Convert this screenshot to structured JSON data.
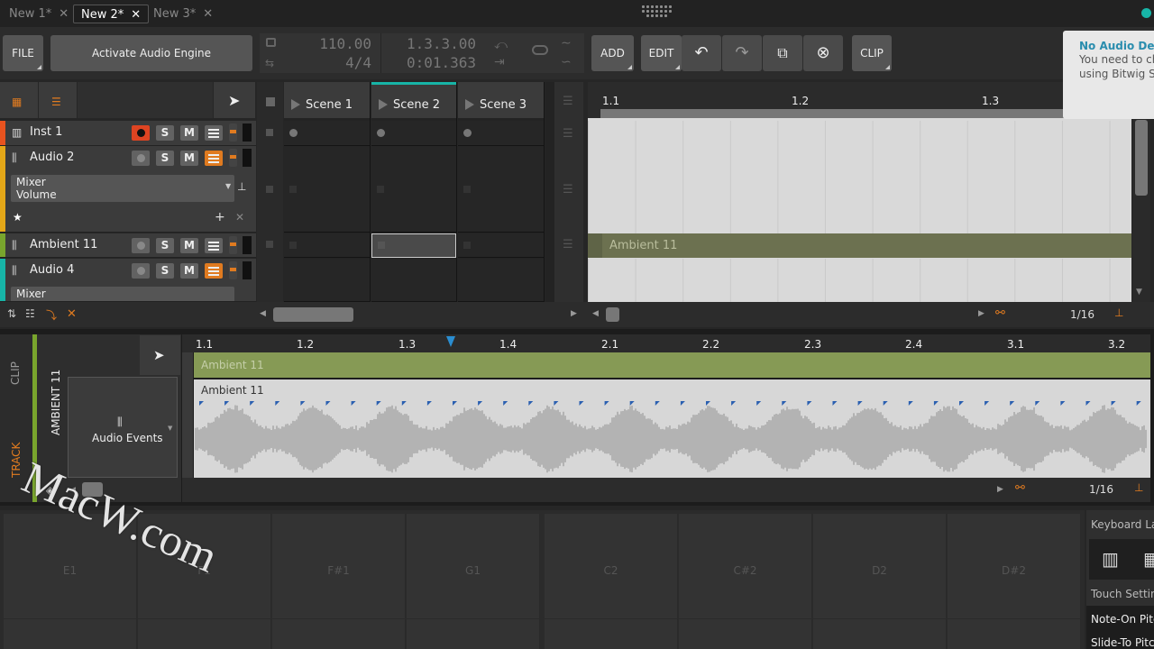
{
  "tabs": [
    {
      "label": "New 1*"
    },
    {
      "label": "New 2*"
    },
    {
      "label": "New 3*"
    }
  ],
  "toolbar": {
    "file": "FILE",
    "activate": "Activate Audio Engine",
    "tempo": "110.00",
    "signature": "4/4",
    "position": "1.3.3.00",
    "time": "0:01.363",
    "add": "ADD",
    "edit": "EDIT",
    "clip": "CLIP"
  },
  "notification": {
    "title": "No Audio Devic",
    "line1": "You need to che",
    "line2": "using Bitwig Stu"
  },
  "scenes": [
    "Scene 1",
    "Scene 2",
    "Scene 3"
  ],
  "tracks": [
    {
      "name": "Inst 1",
      "color": "#e8531f"
    },
    {
      "name": "Audio 2",
      "color": "#e4a718"
    },
    {
      "name": "Ambient 11",
      "color": "#79a52d"
    },
    {
      "name": "Audio 4",
      "color": "#17b5a7"
    }
  ],
  "track_buttons": {
    "solo": "S",
    "mute": "M"
  },
  "device_panel": {
    "mixer": "Mixer",
    "volume": "Volume",
    "mixer2": "Mixer"
  },
  "arranger": {
    "ruler": [
      "1.1",
      "1.2",
      "1.3"
    ],
    "clip_label": "Ambient 11",
    "quantize": "1/16"
  },
  "editor": {
    "clip_tab": "CLIP",
    "track_tab": "TRACK",
    "track_name": "AMBIENT 11",
    "audio_events": "Audio Events",
    "ruler": [
      "1.1",
      "1.2",
      "1.3",
      "1.4",
      "2.1",
      "2.2",
      "2.3",
      "2.4",
      "3.1",
      "3.2"
    ],
    "clip_label": "Ambient 11",
    "event_label": "Ambient 11",
    "quantize": "1/16"
  },
  "keyboard": {
    "notes": [
      "E1",
      "F1",
      "F#1",
      "G1",
      "C2",
      "C#2",
      "D2",
      "D#2"
    ]
  },
  "side_panel": {
    "keyboard_layout": "Keyboard Lay",
    "touch_settings": "Touch Setting",
    "note_on": "Note-On Pitc",
    "slide_to": "Slide-To Pitc"
  },
  "watermark": "MacW.com",
  "colors": {
    "accent": "#e07b20",
    "teal": "#17b5a7",
    "green_clip": "#869a55"
  }
}
